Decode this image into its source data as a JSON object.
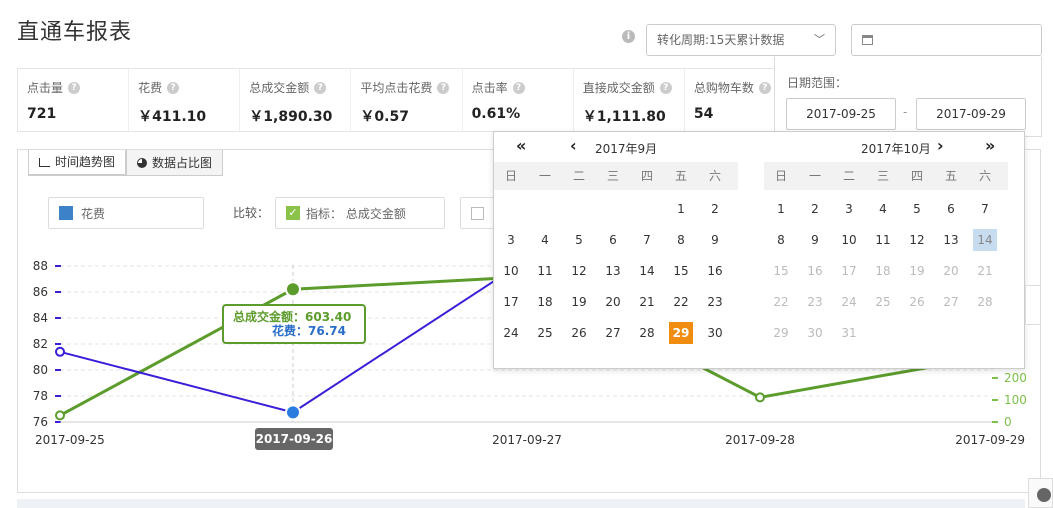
{
  "header": {
    "title": "直通车报表",
    "cycle_label": "转化周期:15天累计数据",
    "date_value": ""
  },
  "metrics": [
    {
      "label": "点击量",
      "value": "721"
    },
    {
      "label": "花费",
      "value": "￥411.10"
    },
    {
      "label": "总成交金额",
      "value": "￥1,890.30"
    },
    {
      "label": "平均点击花费",
      "value": "￥0.57"
    },
    {
      "label": "点击率",
      "value": "0.61%"
    },
    {
      "label": "直接成交金额",
      "value": "￥1,111.80"
    },
    {
      "label": "总购物车数",
      "value": "54"
    }
  ],
  "chart_panel": {
    "tab_trend": "时间趋势图",
    "tab_share": "数据占比图",
    "legend_series": "花费",
    "compare_label": "比较：",
    "compare_metric": "指标： 总成交金额"
  },
  "tooltip": {
    "line1_label": "总成交金额：",
    "line1_value": "603.40",
    "line2_label": "花费：",
    "line2_value": "76.74",
    "x_label": "2017-09-26"
  },
  "chart_data": {
    "type": "line",
    "x": [
      "2017-09-25",
      "2017-09-26",
      "2017-09-27",
      "2017-09-28",
      "2017-09-29"
    ],
    "left_axis": {
      "ticks": [
        76,
        78,
        80,
        82,
        84,
        86,
        88
      ],
      "color": "#3a1fd8"
    },
    "right_axis": {
      "ticks_visible": [
        0,
        100,
        200
      ],
      "color": "#7cbf4a"
    },
    "series": [
      {
        "name": "花费",
        "axis": "left",
        "color": "#3a1fd8",
        "values": [
          81.4,
          76.74,
          88.5,
          null,
          null
        ]
      },
      {
        "name": "总成交金额",
        "axis": "right",
        "color": "#5c9c2c",
        "values": [
          30,
          603.4,
          660,
          112,
          300
        ]
      }
    ]
  },
  "date_picker": {
    "range_label": "日期范围：",
    "start": "2017-09-25",
    "dash": "-",
    "end": "2017-09-29",
    "nav_prev_year": "«",
    "nav_prev_month": "‹",
    "nav_next_month": "›",
    "nav_next_year": "»",
    "left_month": "2017年9月",
    "right_month": "2017年10月",
    "weekdays": [
      "日",
      "一",
      "二",
      "三",
      "四",
      "五",
      "六"
    ],
    "sep_start_offset": 5,
    "sep_days": 30,
    "sep_selected": 29,
    "oct_start_offset": 0,
    "oct_days": 31,
    "oct_today": 14,
    "oct_dim_from": 15
  }
}
